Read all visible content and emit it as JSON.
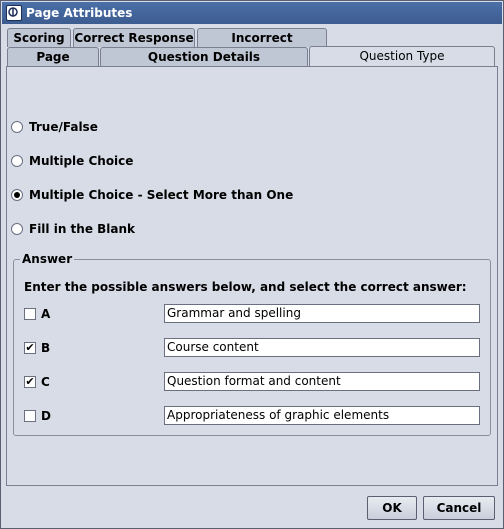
{
  "window": {
    "title": "Page Attributes",
    "icon": "app-icon"
  },
  "tabs_back": [
    "Scoring",
    "Correct Response",
    "Incorrect Response"
  ],
  "tabs_front": [
    "Page",
    "Question Details",
    "Question Type"
  ],
  "active_tab": "Question Type",
  "question_types": [
    {
      "label": "True/False",
      "checked": false
    },
    {
      "label": "Multiple Choice",
      "checked": false
    },
    {
      "label": "Multiple Choice - Select More than One",
      "checked": true
    },
    {
      "label": "Fill in the Blank",
      "checked": false
    }
  ],
  "answer": {
    "group_title": "Answer",
    "instructions": "Enter the possible answers below, and select the correct answer:",
    "rows": [
      {
        "letter": "A",
        "checked": false,
        "value": "Grammar and spelling"
      },
      {
        "letter": "B",
        "checked": true,
        "value": "Course content"
      },
      {
        "letter": "C",
        "checked": true,
        "value": "Question format and content"
      },
      {
        "letter": "D",
        "checked": false,
        "value": "Appropriateness of graphic elements"
      }
    ]
  },
  "buttons": {
    "ok": "OK",
    "cancel": "Cancel"
  }
}
